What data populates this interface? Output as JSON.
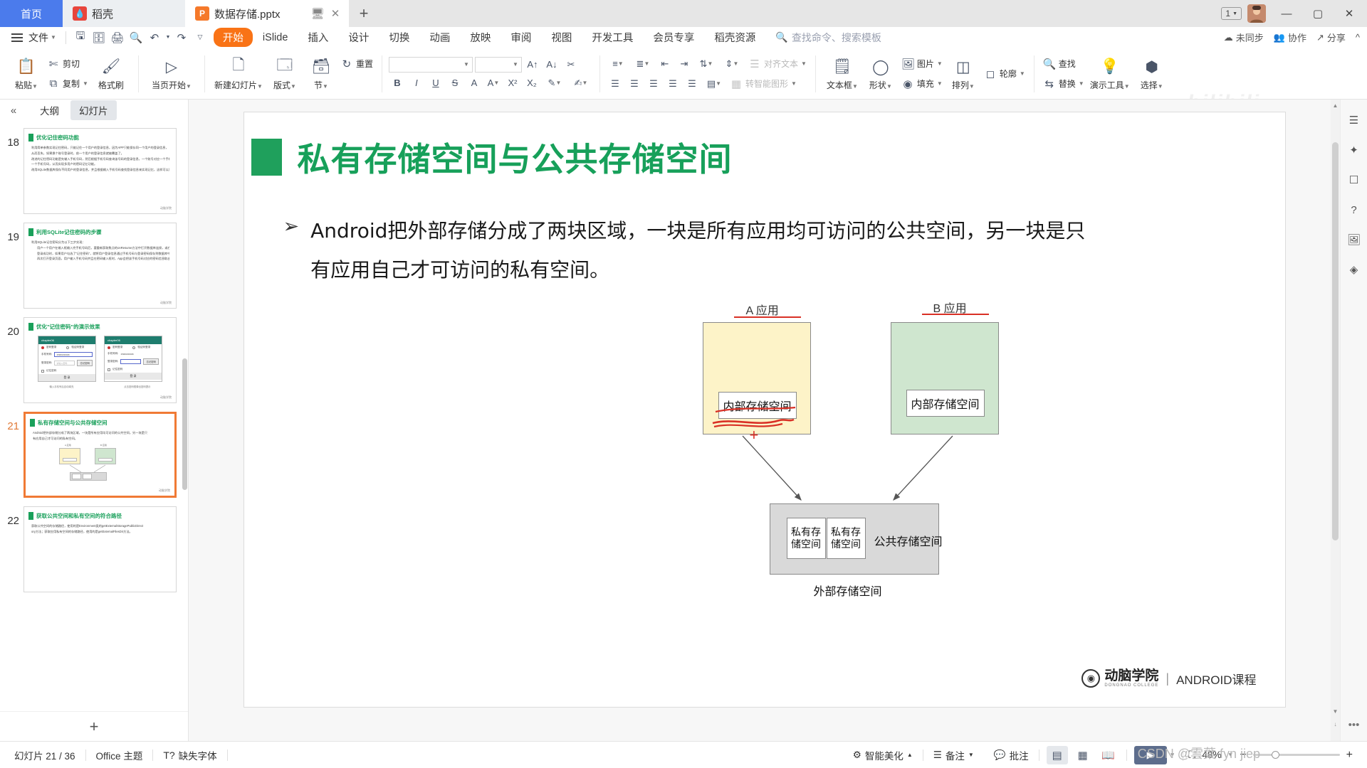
{
  "window": {
    "home_tab": "首页",
    "tabs": [
      {
        "label": "稻壳",
        "icon": "daoke-icon",
        "icon_color": "#e8453c",
        "active": false
      },
      {
        "label": "数据存储.pptx",
        "icon": "pptx-icon",
        "icon_color": "#f5792a",
        "active": true
      }
    ],
    "new_tab_label": "+",
    "restore_badge": "1",
    "minimize": "—",
    "maximize": "▢",
    "close": "✕"
  },
  "menu": {
    "file_label": "文件",
    "quick_access": [
      "save-icon",
      "save-as-icon",
      "print-icon",
      "print-preview-icon",
      "undo-icon",
      "redo-icon",
      "customize-icon"
    ],
    "ribbon_tabs": [
      {
        "label": "开始",
        "active": true
      },
      {
        "label": "iSlide",
        "active": false
      },
      {
        "label": "插入",
        "active": false
      },
      {
        "label": "设计",
        "active": false
      },
      {
        "label": "切换",
        "active": false
      },
      {
        "label": "动画",
        "active": false
      },
      {
        "label": "放映",
        "active": false
      },
      {
        "label": "审阅",
        "active": false
      },
      {
        "label": "视图",
        "active": false
      },
      {
        "label": "开发工具",
        "active": false
      },
      {
        "label": "会员专享",
        "active": false
      },
      {
        "label": "稻壳资源",
        "active": false
      }
    ],
    "search_placeholder": "查找命令、搜索模板",
    "right_items": [
      {
        "label": "未同步",
        "icon": "cloud-icon"
      },
      {
        "label": "协作",
        "icon": "people-icon"
      },
      {
        "label": "分享",
        "icon": "share-icon"
      },
      {
        "label": "",
        "icon": "more-icon"
      }
    ]
  },
  "ribbon": {
    "groups": [
      {
        "name": "clipboard",
        "big": [
          {
            "label": "粘贴",
            "icon": "paste-icon",
            "dropdown": true
          }
        ],
        "small": [
          {
            "label": "剪切",
            "icon": "scissors-icon"
          },
          {
            "label": "复制",
            "icon": "copy-icon",
            "dropdown": true
          }
        ],
        "big2": [
          {
            "label": "格式刷",
            "icon": "format-painter-icon"
          }
        ]
      },
      {
        "name": "present",
        "big": [
          {
            "label": "当页开始",
            "icon": "play-circle-icon",
            "dropdown": true
          }
        ]
      },
      {
        "name": "slides",
        "big": [
          {
            "label": "新建幻灯片",
            "icon": "new-slide-icon",
            "dropdown": true
          },
          {
            "label": "版式",
            "icon": "layout-icon",
            "dropdown": true
          },
          {
            "label": "节",
            "icon": "section-icon",
            "dropdown": true
          }
        ],
        "small": [
          {
            "label": "重置",
            "icon": "reset-icon"
          }
        ]
      },
      {
        "name": "font",
        "font_name": "",
        "font_size": "",
        "tools_row1": [
          "grow-font-icon",
          "shrink-font-icon",
          "clear-format-icon"
        ],
        "tools_row2": [
          "bold-icon",
          "italic-icon",
          "underline-icon",
          "strikethrough-icon",
          "shadow-icon",
          "font-color-icon",
          "superscript-icon",
          "subscript-icon",
          "char-spacing-icon",
          "highlight-icon"
        ]
      },
      {
        "name": "paragraph",
        "tools_row1": [
          "bullets-icon",
          "numbering-icon",
          "decrease-indent-icon",
          "increase-indent-icon",
          "line-spacing-icon",
          "text-direction-icon"
        ],
        "tools_row2": [
          "align-left-icon",
          "align-center-icon",
          "align-right-icon",
          "justify-icon",
          "distribute-icon",
          "columns-icon"
        ],
        "label1": "对齐文本",
        "label2": "转智能图形"
      },
      {
        "name": "drawing",
        "big": [
          {
            "label": "文本框",
            "icon": "textbox-icon",
            "dropdown": true
          },
          {
            "label": "形状",
            "icon": "shapes-icon",
            "dropdown": true
          },
          {
            "label": "排列",
            "icon": "arrange-icon",
            "dropdown": true
          }
        ],
        "small": [
          {
            "label": "图片",
            "icon": "picture-icon",
            "dropdown": true
          },
          {
            "label": "填充",
            "icon": "fill-icon",
            "dropdown": true
          },
          {
            "label": "轮廓",
            "icon": "outline-icon",
            "dropdown": true
          }
        ]
      },
      {
        "name": "editing",
        "big": [
          {
            "label": "演示工具",
            "icon": "present-tools-icon",
            "dropdown": true
          },
          {
            "label": "选择",
            "icon": "select-icon",
            "dropdown": true
          }
        ],
        "small": [
          {
            "label": "查找",
            "icon": "search-icon"
          },
          {
            "label": "替换",
            "icon": "replace-icon",
            "dropdown": true
          }
        ]
      }
    ]
  },
  "slide_panel": {
    "collapse_icon": "chevron-double-left-icon",
    "tabs": [
      {
        "label": "大纲",
        "active": false
      },
      {
        "label": "幻灯片",
        "active": true
      }
    ],
    "add_label": "+",
    "slides": [
      {
        "number": "18",
        "title": "优化记住密码功能",
        "selected": false,
        "lines": [
          "利用简单参数实现记住密码，只能记住一个用户的登录信息，因为APP只能保存同一个用户的登录信息，",
          "从而丢失，如果换个账号登录时，前一个用户的登录信息就被覆盖了。",
          "改进的记住密码功能是先输入手机号码，然后根据手机号码查询该号码的登录信息，一个账号对应一个手机号码，从而实现多用户的密码记忆功能。",
          "一个手机号码，从而实现多用户的密码记忆功能。",
          "改用SQLite数据库保存不同用户的登录信息，并且根据输入手机号码查找登录信息来实现记忆，这样可以同时记住多个手机号码的密码。"
        ],
        "logo": "动脑学院"
      },
      {
        "number": "19",
        "title": "利用SQLite记住密码的步骤",
        "selected": false,
        "lines": [
          "利用SQLite记住密码分为以下三步实现：",
          "用户一个用户在输入框输入完手机号码后，要重新获取焦点的onResume方法中打开数据库连接，或在Focus方法中关闭数据库连接。",
          "登录成功时，如果用户勾选了\"记住密码\"，就将用户登录信息通过手机号码与登录密码保存到数据库中。",
          "再次打开登录页面，用户输入手机号码并且在密码输入框时，App会把该手机号码对应的密码信息取出，并将保存的密码填入密码框。"
        ],
        "logo": "动脑学院"
      },
      {
        "number": "20",
        "title": "优化\"记住密码\"的演示效果",
        "selected": false,
        "phones": [
          {
            "header": "chapter06",
            "radio1": "密码登录",
            "radio2": "验证码登录",
            "field_label1": "手机号码:",
            "field_value1": "15900230046",
            "field_label2": "登录密码:",
            "field_value2": "请输入密码",
            "btn": "忘记密码",
            "checkbox": "记住密码",
            "submit": "登 录"
          },
          {
            "header": "chapter06",
            "radio1": "密码登录",
            "radio2": "验证码登录",
            "field_label1": "手机号码:",
            "field_value1": "15900230046",
            "field_label2": "登录密码:",
            "field_value2": "",
            "btn": "忘记密码",
            "checkbox": "记住密码",
            "submit": "登 录"
          }
        ],
        "caption1": "输入手机号后自动填充",
        "caption2": "点击密码框弹出密码提示",
        "logo": "动脑学院"
      },
      {
        "number": "21",
        "title": "私有存储空间与公共存储空间",
        "selected": true,
        "lines": [
          "Android把外部存储分成了两块区域，一块是所有应用均可访问的公共空间，另一块是只",
          "有应用自己才可访问的私有空间。"
        ],
        "logo": "动脑学院"
      },
      {
        "number": "22",
        "title": "获取公共空间和私有空间的符合路径",
        "selected": false,
        "lines": [
          "获取公共空间的存储路径，使用的是Environment类的getExternalStoragePublicDirect",
          "ory方法；获取应用私有空间的存储路径，使用的是getExternalFilesDir方法。"
        ],
        "logo": "动脑学院"
      }
    ]
  },
  "slide": {
    "title": "私有存储空间与公共存储空间",
    "bullet_mark": "➢",
    "body_line1": "Android把外部存储分成了两块区域，一块是所有应用均可访问的公共空间，另一块是只",
    "body_line2": "有应用自己才可访问的私有空间。",
    "diagram": {
      "app_a_label": "A 应用",
      "app_b_label": "B 应用",
      "app_a_color": "#fdf3c8",
      "app_b_color": "#cfe6cf",
      "inner_a": "内部存储空间",
      "inner_b": "内部存储空间",
      "private_a": "私有存储空间",
      "private_b": "私有存储空间",
      "public_label": "公共存储空间",
      "external_caption": "外部存储空间",
      "annotation_color": "#d93025",
      "annotation_plus": "+"
    },
    "brand": {
      "cn": "动脑学院",
      "en": "DONGNAO COLLEGE",
      "separator": "|",
      "course": "ANDROID课程"
    }
  },
  "right_rail": {
    "icons": [
      "settings-slider-icon",
      "sparkle-icon",
      "frame-icon",
      "help-icon",
      "image-tool-icon",
      "diamond-icon"
    ],
    "more": "•••"
  },
  "status_bar": {
    "slide_count": "幻灯片 21 / 36",
    "theme": "Office 主题",
    "missing_font": "缺失字体",
    "beautify": "智能美化",
    "notes": "备注",
    "comments": "批注",
    "views": [
      {
        "name": "normal-view",
        "active": true
      },
      {
        "name": "slide-sorter-view",
        "active": false
      },
      {
        "name": "reading-view",
        "active": false
      }
    ],
    "play": "▶",
    "fit_icon": "fit-slide-icon",
    "zoom_level": "48%",
    "zoom_out": "−",
    "zoom_in": "+",
    "watermark": "CSDN @雲葉 fyn jiep"
  }
}
